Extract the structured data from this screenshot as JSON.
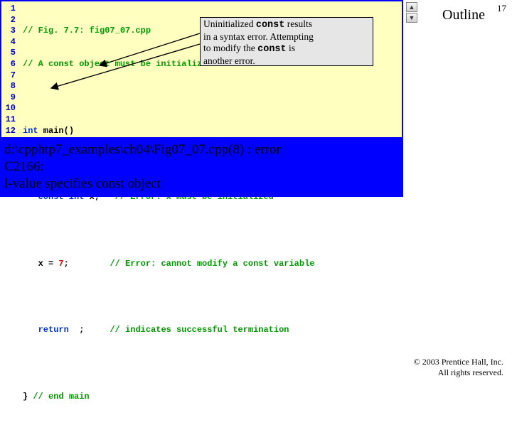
{
  "slide": {
    "number": "17",
    "outline": "Outline"
  },
  "nav": {
    "up": "▲",
    "down": "▼"
  },
  "gutter": [
    "1",
    "2",
    "3",
    "4",
    "5",
    "6",
    "7",
    "8",
    "9",
    "10",
    "11",
    "12"
  ],
  "code": {
    "l1": "// Fig. 7.7: fig07_07.cpp",
    "l2": "// A const object must be initialized",
    "l3": "",
    "l4a": "int",
    "l4b": " main()",
    "l5": "{",
    "l6a": "   const int",
    "l6b": " x;",
    "l6c": "   // Error: x must be initialized",
    "l7": "",
    "l8a": "   x = ",
    "l8b": "7",
    "l8c": ";        ",
    "l8d": "// Error: cannot modify a const variable",
    "l9": "",
    "l10a": "   return  ",
    "l10b": ";",
    "l10c": "     ",
    "l10d": "// indicates successful termination",
    "l11": "",
    "l12a": "} ",
    "l12b": "// end main"
  },
  "callout": {
    "t1a": "Uninitialized ",
    "t1b": "const",
    "t1c": " results",
    "t2": "in a syntax error. Attempting",
    "t3a": "to modify the ",
    "t3b": "const",
    "t3c": " is",
    "t4": "another error."
  },
  "error": {
    "line1": "d:\\cpphtp7_examples\\ch04\\Fig07_07.cpp(8) : error",
    "line2": "C2166:",
    "line3": "l-value specifies const object"
  },
  "copyright": {
    "line1": "© 2003 Prentice Hall, Inc.",
    "line2": "All rights reserved."
  }
}
